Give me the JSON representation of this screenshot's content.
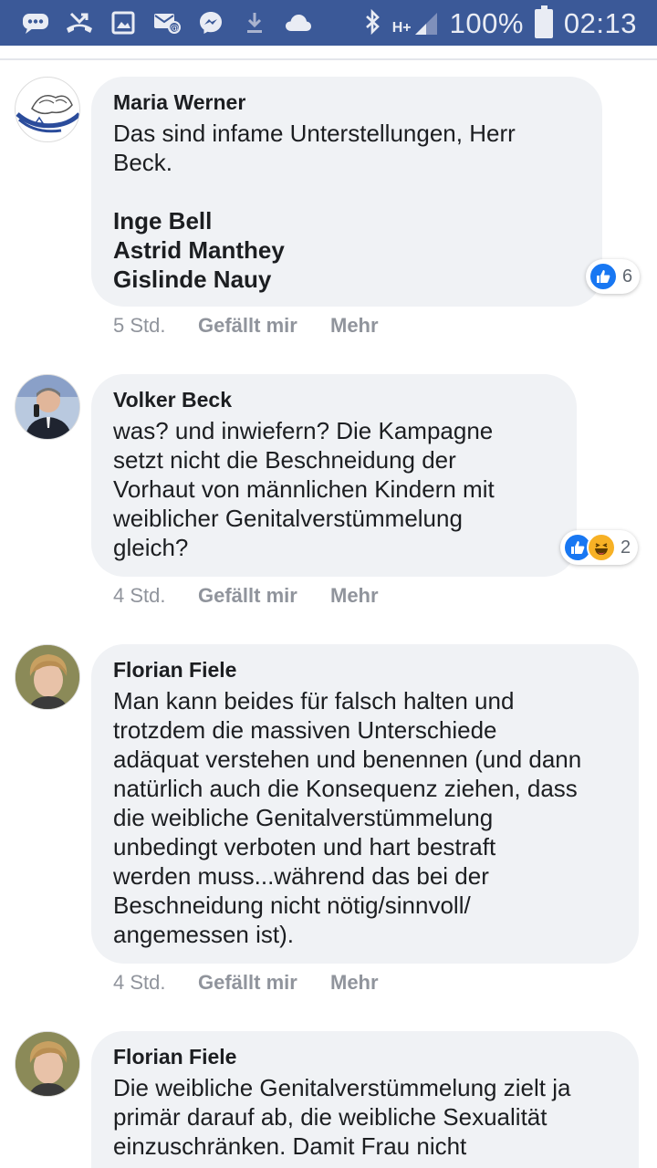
{
  "status_bar": {
    "battery": "100%",
    "time": "02:13",
    "network": "H+",
    "left_icons": [
      "chat-icon",
      "missed-call-icon",
      "image-icon",
      "email-icon",
      "messenger-icon",
      "download-icon",
      "cloud-icon"
    ],
    "bar_color": "#3b5998"
  },
  "comments": [
    {
      "author": "Maria Werner",
      "text": "Das sind infame Unterstellungen, Herr\nBeck.",
      "mentions": [
        "Inge Bell",
        "Astrid Manthey",
        "Gislinde Nauy"
      ],
      "reactions": {
        "types": [
          "like"
        ],
        "count": "6"
      },
      "time": "5 Std.",
      "like_label": "Gefällt mir",
      "more_label": "Mehr"
    },
    {
      "author": "Volker Beck",
      "text": "was? und inwiefern? Die Kampagne\nsetzt nicht die Beschneidung der\nVorhaut von männlichen Kindern mit\nweiblicher Genitalverstümmelung\ngleich?",
      "reactions": {
        "types": [
          "like",
          "haha"
        ],
        "count": "2"
      },
      "time": "4 Std.",
      "like_label": "Gefällt mir",
      "more_label": "Mehr"
    },
    {
      "author": "Florian Fiele",
      "text": "Man kann beides für falsch halten und\ntrotzdem die massiven Unterschiede\nadäquat verstehen und benennen (und dann\nnatürlich auch die Konsequenz ziehen, dass\ndie weibliche Genitalverstümmelung\nunbedingt verboten und hart bestraft\nwerden muss...während das bei der\nBeschneidung nicht nötig/sinnvoll/\nangemessen ist).",
      "time": "4 Std.",
      "like_label": "Gefällt mir",
      "more_label": "Mehr"
    },
    {
      "author": "Florian Fiele",
      "text": "Die weibliche Genitalverstümmelung zielt ja\nprimär darauf ab, die weibliche Sexualität\neinzuschränken. Damit Frau nicht"
    }
  ]
}
